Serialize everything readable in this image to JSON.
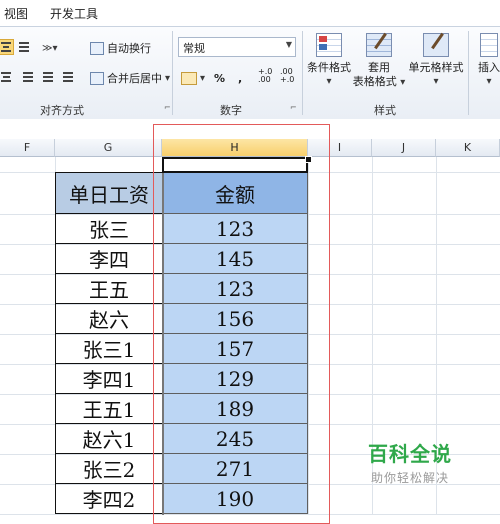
{
  "menu": {
    "tabs": [
      "视图",
      "开发工具"
    ]
  },
  "ribbon": {
    "alignment": {
      "wrap_text_label": "自动换行",
      "merge_center_label": "合并后居中",
      "group_label": "对齐方式"
    },
    "number": {
      "format_value": "常规",
      "percent_symbol": "%",
      "comma_symbol": ",",
      "increase_decimal": "+.0\n.00",
      "decrease_decimal": ".00\n+.0",
      "group_label": "数字"
    },
    "styles": {
      "conditional_format_label": "条件格式",
      "table_format_label_line1": "套用",
      "table_format_label_line2": "表格格式",
      "cell_style_label": "单元格样式",
      "group_label": "样式"
    },
    "cells": {
      "insert_label": "插入"
    }
  },
  "grid": {
    "columns": [
      "F",
      "G",
      "H",
      "I",
      "J",
      "K"
    ],
    "selected_column": "H",
    "header_g": "单日工资",
    "header_h": "金额",
    "rows": [
      {
        "name": "张三",
        "amount": "123"
      },
      {
        "name": "李四",
        "amount": "145"
      },
      {
        "name": "王五",
        "amount": "123"
      },
      {
        "name": "赵六",
        "amount": "156"
      },
      {
        "name": "张三1",
        "amount": "157"
      },
      {
        "name": "李四1",
        "amount": "129"
      },
      {
        "name": "王五1",
        "amount": "189"
      },
      {
        "name": "赵六1",
        "amount": "245"
      },
      {
        "name": "张三2",
        "amount": "271"
      },
      {
        "name": "李四2",
        "amount": "190"
      }
    ]
  },
  "watermark": {
    "title": "百科全说",
    "subtitle": "助你轻松解决"
  },
  "colors": {
    "header_g_fill": "#b8cce4",
    "header_h_fill": "#8fb5e6",
    "selection_fill": "#bcd6f4",
    "highlight_border": "#e35a5a",
    "watermark_green": "#2fa84a"
  }
}
